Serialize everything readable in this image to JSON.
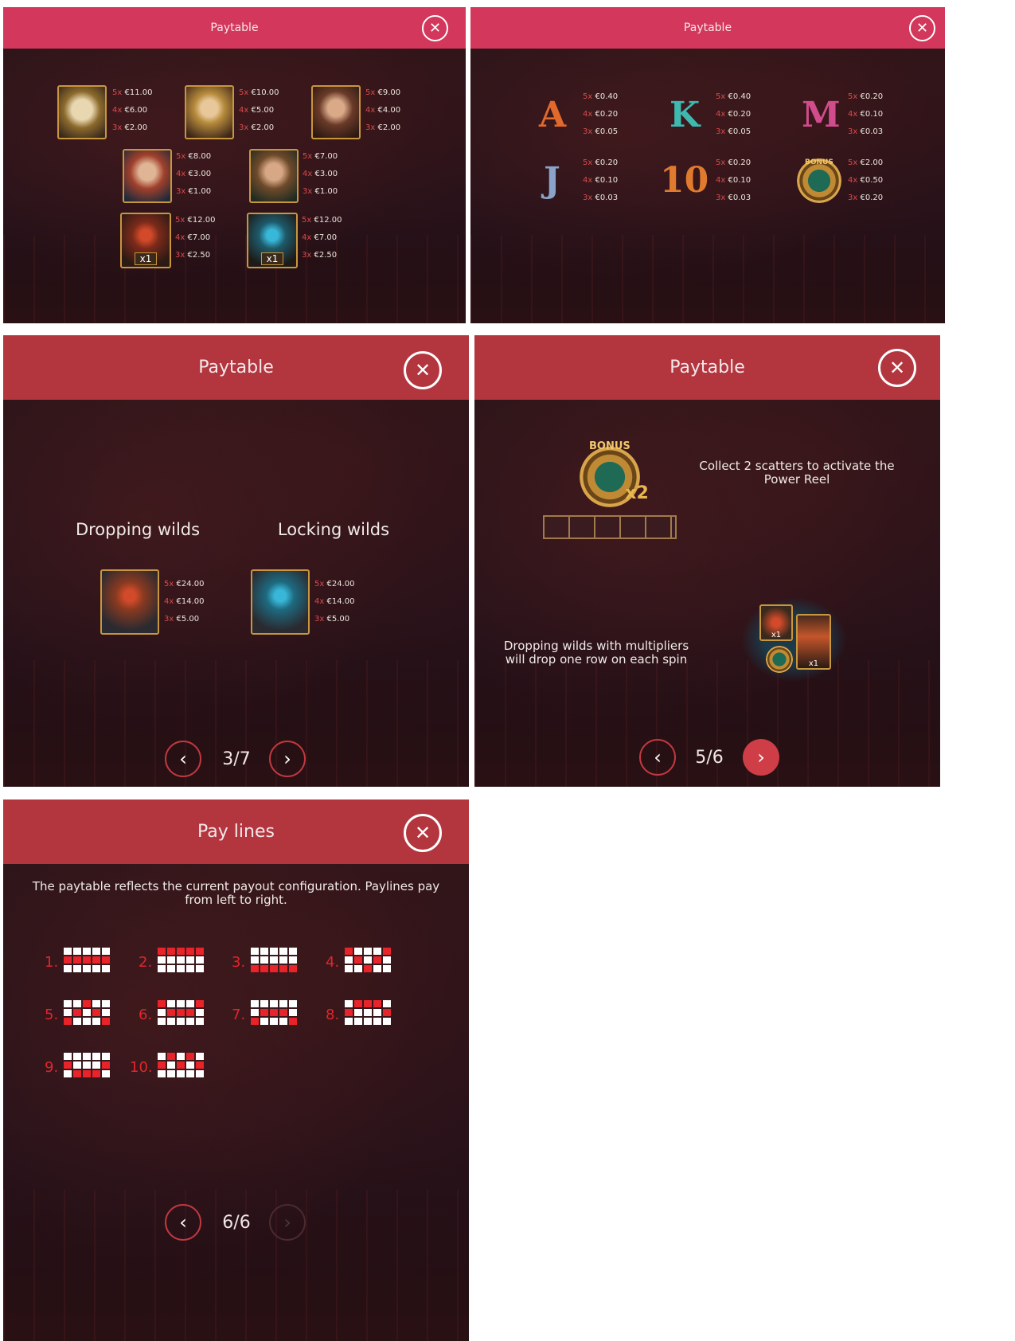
{
  "panels": {
    "p1": {
      "title": "Paytable",
      "close_icon": "close-icon",
      "symbols": [
        {
          "name": "dwarf-viking",
          "pays": [
            "5x",
            "€11.00",
            "4x",
            "€6.00",
            "3x",
            "€2.00"
          ]
        },
        {
          "name": "blonde-valkyrie",
          "pays": [
            "5x",
            "€10.00",
            "4x",
            "€5.00",
            "3x",
            "€2.00"
          ]
        },
        {
          "name": "dark-valkyrie",
          "pays": [
            "5x",
            "€9.00",
            "4x",
            "€4.00",
            "3x",
            "€2.00"
          ]
        },
        {
          "name": "red-hair-viking",
          "pays": [
            "5x",
            "€8.00",
            "4x",
            "€3.00",
            "3x",
            "€1.00"
          ]
        },
        {
          "name": "brown-hair-viking",
          "pays": [
            "5x",
            "€7.00",
            "4x",
            "€3.00",
            "3x",
            "€1.00"
          ]
        },
        {
          "name": "red-wild",
          "badge": "x1",
          "pays": [
            "5x",
            "€12.00",
            "4x",
            "€7.00",
            "3x",
            "€2.50"
          ]
        },
        {
          "name": "blue-wild",
          "badge": "x1",
          "pays": [
            "5x",
            "€12.00",
            "4x",
            "€7.00",
            "3x",
            "€2.50"
          ]
        }
      ]
    },
    "p2": {
      "title": "Paytable",
      "close_icon": "close-icon",
      "symbols": [
        {
          "glyph": "A",
          "color": "#e0692b",
          "pays": [
            "5x",
            "€0.40",
            "4x",
            "€0.20",
            "3x",
            "€0.05"
          ]
        },
        {
          "glyph": "K",
          "color": "#3fb8b0",
          "pays": [
            "5x",
            "€0.40",
            "4x",
            "€0.20",
            "3x",
            "€0.05"
          ]
        },
        {
          "glyph": "M",
          "color": "#d04c8c",
          "pays": [
            "5x",
            "€0.20",
            "4x",
            "€0.10",
            "3x",
            "€0.03"
          ]
        },
        {
          "glyph": "J",
          "color": "#8aa3c8",
          "pays": [
            "5x",
            "€0.20",
            "4x",
            "€0.10",
            "3x",
            "€0.03"
          ]
        },
        {
          "glyph": "10",
          "color": "#e07a2e",
          "pays": [
            "5x",
            "€0.20",
            "4x",
            "€0.10",
            "3x",
            "€0.03"
          ]
        },
        {
          "glyph": "BONUS",
          "color": "#d9a54a",
          "pays": [
            "5x",
            "€2.00",
            "4x",
            "€0.50",
            "3x",
            "€0.20"
          ]
        }
      ]
    },
    "p3": {
      "title": "Paytable",
      "heading_left": "Dropping wilds",
      "heading_right": "Locking wilds",
      "wild_left": {
        "pays": [
          "5x",
          "€24.00",
          "4x",
          "€14.00",
          "3x",
          "€5.00"
        ]
      },
      "wild_right": {
        "pays": [
          "5x",
          "€24.00",
          "4x",
          "€14.00",
          "3x",
          "€5.00"
        ]
      },
      "pager": "3/7"
    },
    "p4": {
      "title": "Paytable",
      "bonus_label": "BONUS",
      "multiplier": "x2",
      "scatter_text": "Collect 2 scatters to activate the Power Reel",
      "dropping_text": "Dropping wilds with multipliers will drop one row on each spin",
      "badge": "x1",
      "pager": "5/6"
    },
    "p5": {
      "title": "Pay lines",
      "intro": "The paytable reflects the current payout configuration. Paylines pay from left to right.",
      "pager": "6/6",
      "lines": [
        {
          "label": "1.",
          "rows": [
            [
              0,
              0,
              0,
              0,
              0
            ],
            [
              1,
              1,
              1,
              1,
              1
            ],
            [
              0,
              0,
              0,
              0,
              0
            ]
          ]
        },
        {
          "label": "2.",
          "rows": [
            [
              1,
              1,
              1,
              1,
              1
            ],
            [
              0,
              0,
              0,
              0,
              0
            ],
            [
              0,
              0,
              0,
              0,
              0
            ]
          ]
        },
        {
          "label": "3.",
          "rows": [
            [
              0,
              0,
              0,
              0,
              0
            ],
            [
              0,
              0,
              0,
              0,
              0
            ],
            [
              1,
              1,
              1,
              1,
              1
            ]
          ]
        },
        {
          "label": "4.",
          "rows": [
            [
              1,
              0,
              0,
              0,
              1
            ],
            [
              0,
              1,
              0,
              1,
              0
            ],
            [
              0,
              0,
              1,
              0,
              0
            ]
          ]
        },
        {
          "label": "5.",
          "rows": [
            [
              0,
              0,
              1,
              0,
              0
            ],
            [
              0,
              1,
              0,
              1,
              0
            ],
            [
              1,
              0,
              0,
              0,
              1
            ]
          ]
        },
        {
          "label": "6.",
          "rows": [
            [
              1,
              0,
              0,
              0,
              1
            ],
            [
              0,
              1,
              1,
              1,
              0
            ],
            [
              0,
              0,
              0,
              0,
              0
            ]
          ]
        },
        {
          "label": "7.",
          "rows": [
            [
              0,
              0,
              0,
              0,
              0
            ],
            [
              0,
              1,
              1,
              1,
              0
            ],
            [
              1,
              0,
              0,
              0,
              1
            ]
          ]
        },
        {
          "label": "8.",
          "rows": [
            [
              0,
              1,
              1,
              1,
              0
            ],
            [
              1,
              0,
              0,
              0,
              1
            ],
            [
              0,
              0,
              0,
              0,
              0
            ]
          ]
        },
        {
          "label": "9.",
          "rows": [
            [
              0,
              0,
              0,
              0,
              0
            ],
            [
              1,
              0,
              0,
              0,
              1
            ],
            [
              0,
              1,
              1,
              1,
              0
            ]
          ]
        },
        {
          "label": "10.",
          "rows": [
            [
              0,
              1,
              0,
              1,
              0
            ],
            [
              1,
              0,
              1,
              0,
              1
            ],
            [
              0,
              0,
              0,
              0,
              0
            ]
          ]
        }
      ]
    }
  },
  "colors": {
    "header_pink": "#d3375b",
    "header_red": "#b3363f",
    "multiplier_red": "#d84b4b",
    "payline_red": "#e8242a"
  }
}
